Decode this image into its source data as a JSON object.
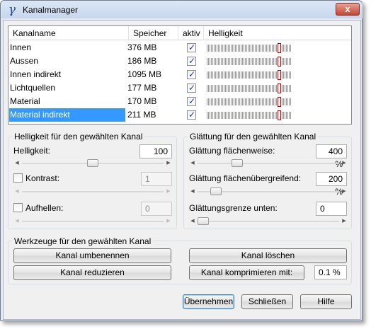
{
  "window": {
    "title": "Kanalmanager",
    "app_icon": "app-logo-icon",
    "close_label": "x"
  },
  "channel_list": {
    "columns": [
      "Kanalname",
      "Speicher",
      "aktiv",
      "Helligkeit"
    ],
    "rows": [
      {
        "name": "Innen",
        "memory": "376 MB",
        "active": true,
        "brightness": 1.0,
        "selected": false
      },
      {
        "name": "Aussen",
        "memory": "186 MB",
        "active": true,
        "brightness": 1.0,
        "selected": false
      },
      {
        "name": "Innen indirekt",
        "memory": "1095 MB",
        "active": true,
        "brightness": 1.0,
        "selected": false
      },
      {
        "name": "Lichtquellen",
        "memory": "177 MB",
        "active": true,
        "brightness": 1.0,
        "selected": false
      },
      {
        "name": "Material",
        "memory": "170 MB",
        "active": true,
        "brightness": 1.0,
        "selected": false
      },
      {
        "name": "Material indirekt",
        "memory": "211 MB",
        "active": true,
        "brightness": 1.0,
        "selected": true
      }
    ]
  },
  "brightness_group": {
    "title": "Helligkeit für den gewählten Kanal",
    "brightness_label": "Helligkeit:",
    "brightness_value": "100",
    "brightness_level": 0.5,
    "contrast_label": "Kontrast:",
    "contrast_value": "1",
    "contrast_checked": false,
    "brighten_label": "Aufhellen:",
    "brighten_value": "0",
    "brighten_checked": false
  },
  "smoothing_group": {
    "title": "Glättung für den gewählten Kanal",
    "surface_label": "Glättung flächenweise:",
    "surface_value": "400 %",
    "surface_level": 0.26,
    "cross_label": "Glättung flächenübergreifend:",
    "cross_value": "200 %",
    "cross_level": 0.1,
    "limit_label": "Glättungsgrenze unten:",
    "limit_value": "0",
    "limit_level": 0.0
  },
  "tools_group": {
    "title": "Werkzeuge für den gewählten Kanal",
    "rename_label": "Kanal umbenennen",
    "delete_label": "Kanal löschen",
    "reduce_label": "Kanal reduzieren",
    "compress_label": "Kanal komprimieren mit:",
    "compress_value": "0.1 %"
  },
  "footer": {
    "apply_label": "Übernehmen",
    "close_label": "Schließen",
    "help_label": "Hilfe"
  }
}
